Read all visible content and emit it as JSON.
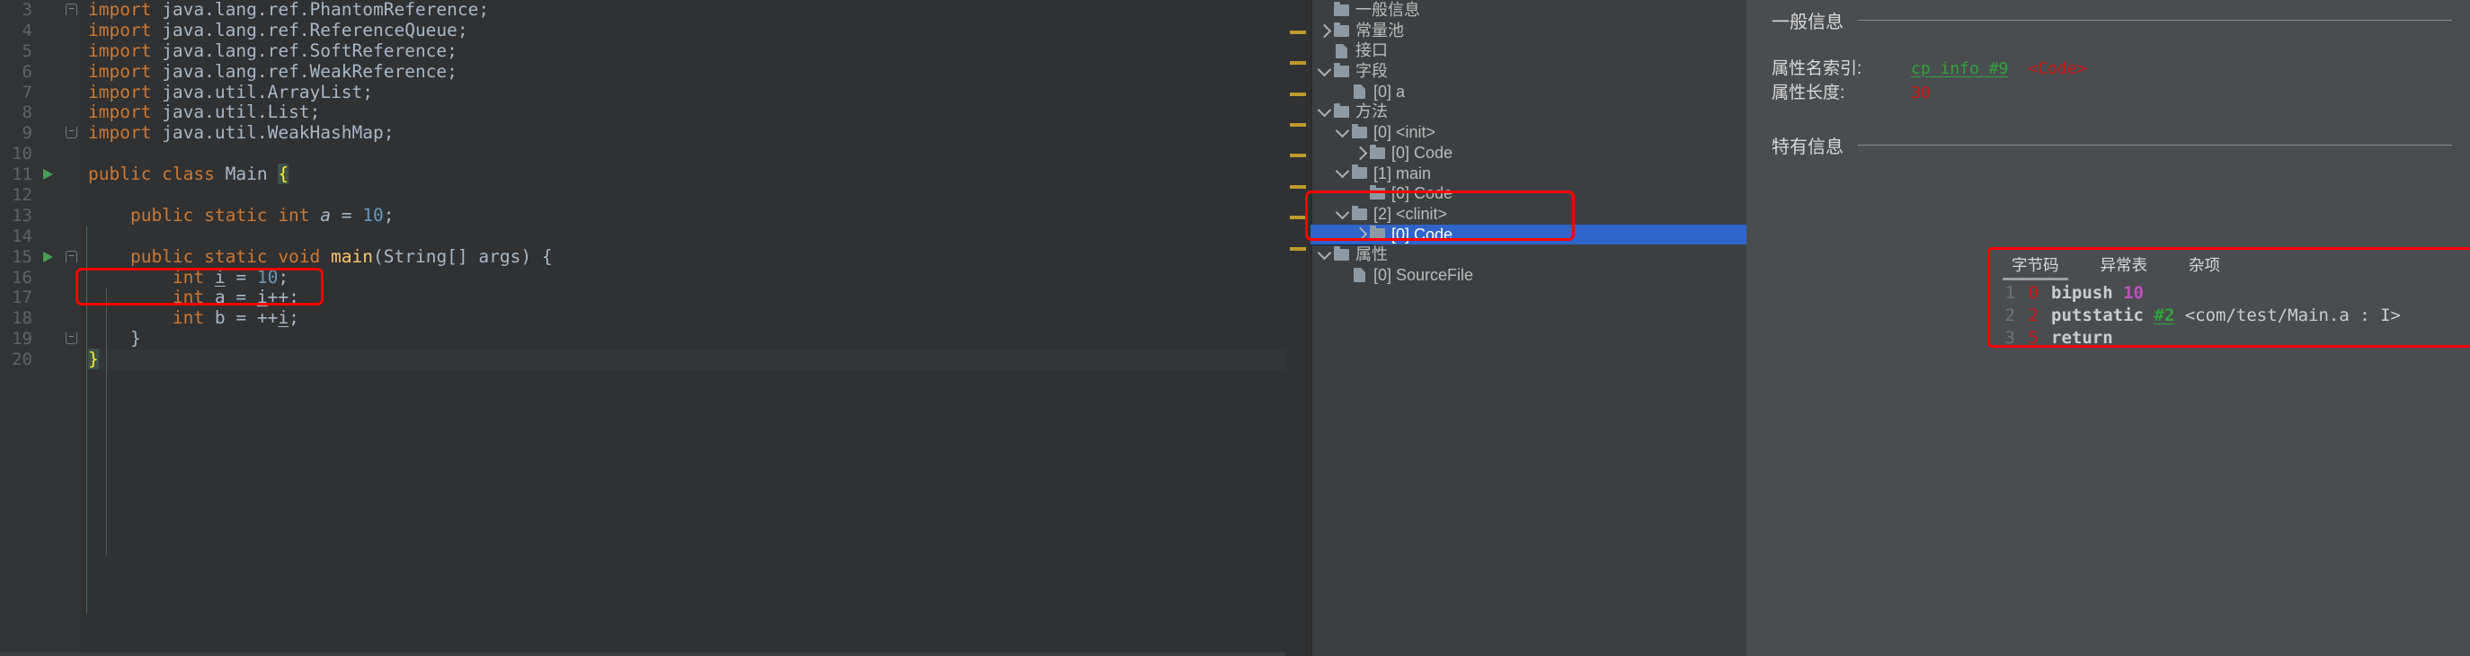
{
  "editor": {
    "lines": [
      {
        "num": "3",
        "fold": "down",
        "run": false,
        "tokens": [
          {
            "t": "import ",
            "c": "kw"
          },
          {
            "t": "java.lang.ref.PhantomReference;",
            "c": "plain"
          }
        ]
      },
      {
        "num": "4",
        "fold": "",
        "run": false,
        "tokens": [
          {
            "t": "import ",
            "c": "kw"
          },
          {
            "t": "java.lang.ref.ReferenceQueue;",
            "c": "plain"
          }
        ]
      },
      {
        "num": "5",
        "fold": "",
        "run": false,
        "tokens": [
          {
            "t": "import ",
            "c": "kw"
          },
          {
            "t": "java.lang.ref.SoftReference;",
            "c": "plain"
          }
        ]
      },
      {
        "num": "6",
        "fold": "",
        "run": false,
        "tokens": [
          {
            "t": "import ",
            "c": "kw"
          },
          {
            "t": "java.lang.ref.WeakReference;",
            "c": "plain"
          }
        ]
      },
      {
        "num": "7",
        "fold": "",
        "run": false,
        "tokens": [
          {
            "t": "import ",
            "c": "kw"
          },
          {
            "t": "java.util.ArrayList;",
            "c": "plain"
          }
        ]
      },
      {
        "num": "8",
        "fold": "",
        "run": false,
        "tokens": [
          {
            "t": "import ",
            "c": "kw"
          },
          {
            "t": "java.util.List;",
            "c": "plain"
          }
        ]
      },
      {
        "num": "9",
        "fold": "up",
        "run": false,
        "tokens": [
          {
            "t": "import ",
            "c": "kw"
          },
          {
            "t": "java.util.WeakHashMap;",
            "c": "plain"
          }
        ]
      },
      {
        "num": "10",
        "fold": "",
        "run": false,
        "tokens": []
      },
      {
        "num": "11",
        "fold": "",
        "run": true,
        "tokens": [
          {
            "t": "public class ",
            "c": "kw"
          },
          {
            "t": "Main ",
            "c": "cls"
          },
          {
            "t": "{",
            "c": "brace-hl"
          }
        ]
      },
      {
        "num": "12",
        "fold": "",
        "run": false,
        "tokens": []
      },
      {
        "num": "13",
        "fold": "",
        "run": false,
        "tokens": [
          {
            "t": "    public static int ",
            "c": "kw"
          },
          {
            "t": "a ",
            "c": "fld"
          },
          {
            "t": "= ",
            "c": "plain"
          },
          {
            "t": "10",
            "c": "num"
          },
          {
            "t": ";",
            "c": "plain"
          }
        ]
      },
      {
        "num": "14",
        "fold": "",
        "run": false,
        "tokens": []
      },
      {
        "num": "15",
        "fold": "down",
        "run": true,
        "tokens": [
          {
            "t": "    public static void ",
            "c": "kw"
          },
          {
            "t": "main",
            "c": "mth"
          },
          {
            "t": "(String[] args) {",
            "c": "plain"
          }
        ]
      },
      {
        "num": "16",
        "fold": "",
        "run": false,
        "tokens": [
          {
            "t": "        int ",
            "c": "kw"
          },
          {
            "t": "i",
            "c": "loc u"
          },
          {
            "t": " = ",
            "c": "plain"
          },
          {
            "t": "10",
            "c": "num"
          },
          {
            "t": ";",
            "c": "plain"
          }
        ]
      },
      {
        "num": "17",
        "fold": "",
        "run": false,
        "tokens": [
          {
            "t": "        int ",
            "c": "kw"
          },
          {
            "t": "a",
            "c": "loc"
          },
          {
            "t": " = ",
            "c": "plain"
          },
          {
            "t": "i",
            "c": "loc u"
          },
          {
            "t": "++;",
            "c": "plain"
          }
        ]
      },
      {
        "num": "18",
        "fold": "",
        "run": false,
        "tokens": [
          {
            "t": "        int ",
            "c": "kw"
          },
          {
            "t": "b",
            "c": "loc"
          },
          {
            "t": " = ++",
            "c": "plain"
          },
          {
            "t": "i",
            "c": "loc u"
          },
          {
            "t": ";",
            "c": "plain"
          }
        ]
      },
      {
        "num": "19",
        "fold": "up",
        "run": false,
        "tokens": [
          {
            "t": "    }",
            "c": "plain"
          }
        ]
      },
      {
        "num": "20",
        "fold": "",
        "run": false,
        "tokens": [
          {
            "t": "}",
            "c": "brace-hl"
          }
        ]
      }
    ]
  },
  "tree": {
    "items": [
      {
        "indent": 0,
        "arrow": "",
        "icon": "folder",
        "label": "一般信息",
        "selected": false
      },
      {
        "indent": 0,
        "arrow": "right",
        "icon": "folder",
        "label": "常量池",
        "selected": false
      },
      {
        "indent": 0,
        "arrow": "",
        "icon": "file",
        "label": "接口",
        "selected": false
      },
      {
        "indent": 0,
        "arrow": "down",
        "icon": "folder",
        "label": "字段",
        "selected": false
      },
      {
        "indent": 1,
        "arrow": "",
        "icon": "file",
        "label": "[0] a",
        "selected": false
      },
      {
        "indent": 0,
        "arrow": "down",
        "icon": "folder",
        "label": "方法",
        "selected": false
      },
      {
        "indent": 1,
        "arrow": "down",
        "icon": "folder",
        "label": "[0] <init>",
        "selected": false
      },
      {
        "indent": 2,
        "arrow": "right",
        "icon": "folder",
        "label": "[0] Code",
        "selected": false
      },
      {
        "indent": 1,
        "arrow": "down",
        "icon": "folder",
        "label": "[1] main",
        "selected": false
      },
      {
        "indent": 2,
        "arrow": "",
        "icon": "folder",
        "label": "[0] Code",
        "selected": false
      },
      {
        "indent": 1,
        "arrow": "down",
        "icon": "folder",
        "label": "[2] <clinit>",
        "selected": false
      },
      {
        "indent": 2,
        "arrow": "right",
        "icon": "folder",
        "label": "[0] Code",
        "selected": true
      },
      {
        "indent": 0,
        "arrow": "down",
        "icon": "folder",
        "label": "属性",
        "selected": false
      },
      {
        "indent": 1,
        "arrow": "",
        "icon": "file",
        "label": "[0] SourceFile",
        "selected": false
      }
    ]
  },
  "details": {
    "general_header": "一般信息",
    "specific_header": "特有信息",
    "attr_name_index_label": "属性名索引:",
    "attr_name_index_link": "cp_info #9",
    "attr_name_index_value": "<Code>",
    "attr_length_label": "属性长度:",
    "attr_length_value": "30"
  },
  "bytecode": {
    "tabs": [
      {
        "label": "字节码",
        "active": true
      },
      {
        "label": "异常表",
        "active": false
      },
      {
        "label": "杂项",
        "active": false
      }
    ],
    "lines": [
      {
        "ln": "1",
        "offset": "0",
        "op": "bipush",
        "arg": "10",
        "arg_kind": "num",
        "desc": ""
      },
      {
        "ln": "2",
        "offset": "2",
        "op": "putstatic",
        "arg": "#2",
        "arg_kind": "ref",
        "desc": "<com/test/Main.a : I>"
      },
      {
        "ln": "3",
        "offset": "5",
        "op": "return",
        "arg": "",
        "arg_kind": "",
        "desc": ""
      }
    ]
  },
  "colors": {
    "accent_selection": "#2f65ca",
    "highlight_red": "#ff0000",
    "keyword": "#cc7832",
    "number": "#6897bb",
    "method": "#ffc66d",
    "link_green": "#2fa43c",
    "value_red": "#d01414",
    "bytecode_const": "#c050c0",
    "marker_gold": "#bf9a2c"
  }
}
